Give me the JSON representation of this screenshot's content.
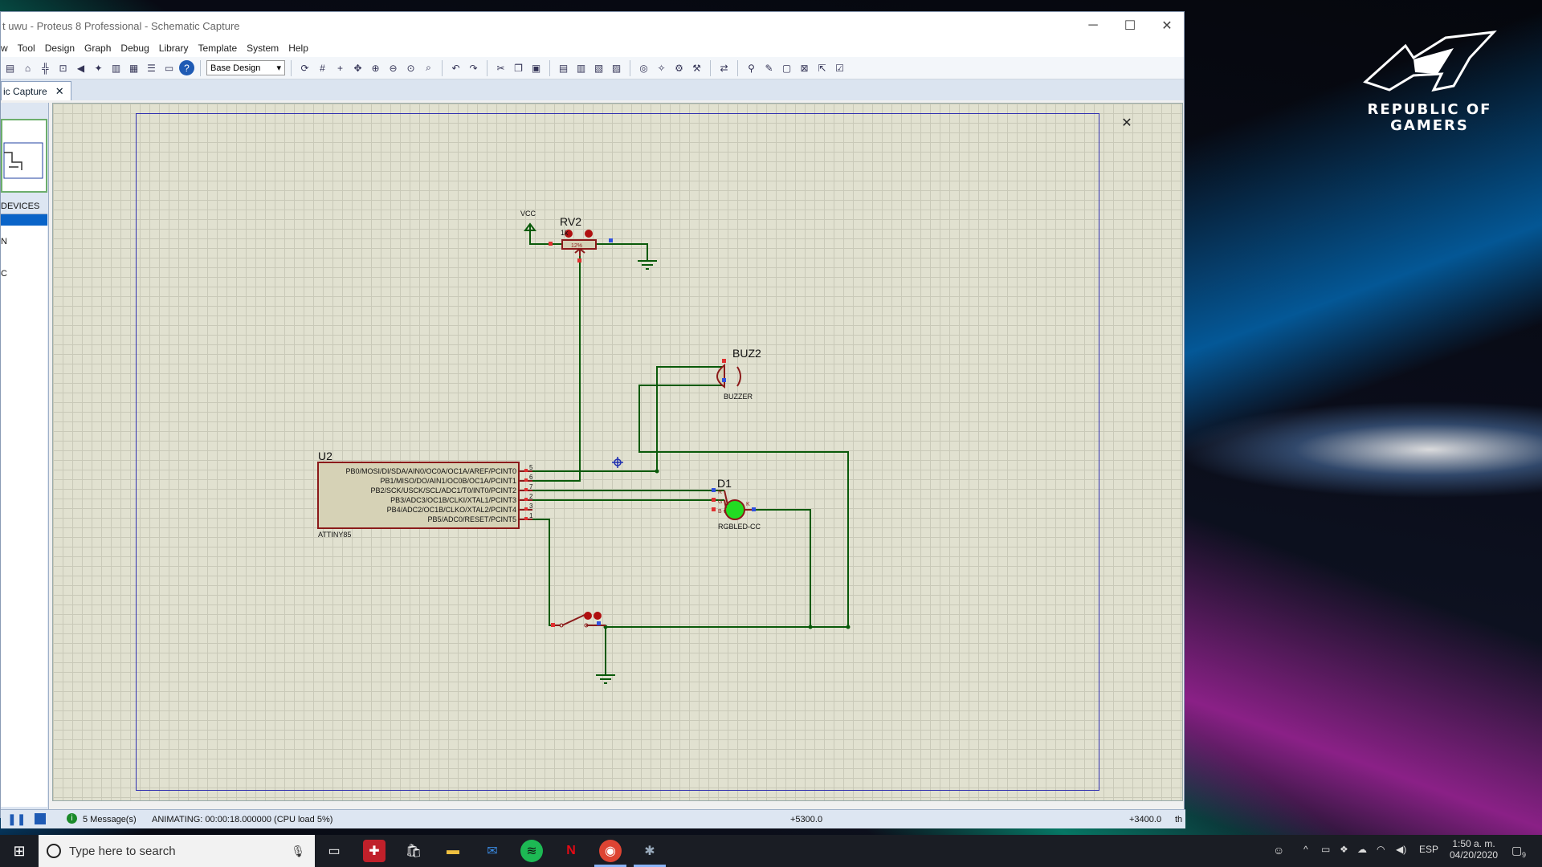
{
  "window": {
    "title": "t uwu - Proteus 8 Professional - Schematic Capture",
    "minimize": "─",
    "maximize": "☐",
    "close": "✕"
  },
  "menu": [
    "w",
    "Tool",
    "Design",
    "Graph",
    "Debug",
    "Library",
    "Template",
    "System",
    "Help"
  ],
  "toolbar": {
    "design_select": "Base Design"
  },
  "tab": {
    "label": "ic Capture",
    "close": "✕"
  },
  "left_panel": {
    "devices_header": "DEVICES",
    "items": [
      "N",
      "C"
    ]
  },
  "schematic": {
    "close_mark": "✕",
    "vcc_label": "VCC",
    "rv2": {
      "ref": "RV2",
      "value": "1k",
      "pct": "12%"
    },
    "buz2": {
      "ref": "BUZ2",
      "part": "BUZZER"
    },
    "u2": {
      "ref": "U2",
      "part": "ATTINY85",
      "pins": [
        {
          "name": "PB0/MOSI/DI/SDA/AIN0/OC0A/OC1A/AREF/PCINT0",
          "num": "5"
        },
        {
          "name": "PB1/MISO/DO/AIN1/OC0B/OC1A/PCINT1",
          "num": "6"
        },
        {
          "name": "PB2/SCK/USCK/SCL/ADC1/T0/INT0/PCINT2",
          "num": "7"
        },
        {
          "name": "PB3/ADC3/OC1B/CLKI/XTAL1/PCINT3",
          "num": "2"
        },
        {
          "name": "PB4/ADC2/OC1B/CLKO/XTAL2/PCINT4",
          "num": "3"
        },
        {
          "name": "PB5/ADC0/RESET/PCINT5",
          "num": "1"
        }
      ]
    },
    "d1": {
      "ref": "D1",
      "part": "RGBLED-CC",
      "pins": [
        "R",
        "G",
        "B",
        "K"
      ]
    },
    "colors": {
      "wire": "#0a5a0a",
      "component": "#8b1a1a",
      "component_fill": "#d6d2b6",
      "led": "#22dd22"
    }
  },
  "status": {
    "messages": "5 Message(s)",
    "animating": "ANIMATING: 00:00:18.000000 (CPU load 5%)",
    "x_coord": "+5300.0",
    "y_coord": "+3400.0",
    "unit": "th"
  },
  "wallpaper": {
    "line1": "REPUBLIC OF",
    "line2": "GAMERS"
  },
  "taskbar": {
    "search_placeholder": "Type here to search",
    "lang": "ESP",
    "time": "1:50 a. m.",
    "date": "04/20/2020",
    "notif_count": "9"
  }
}
